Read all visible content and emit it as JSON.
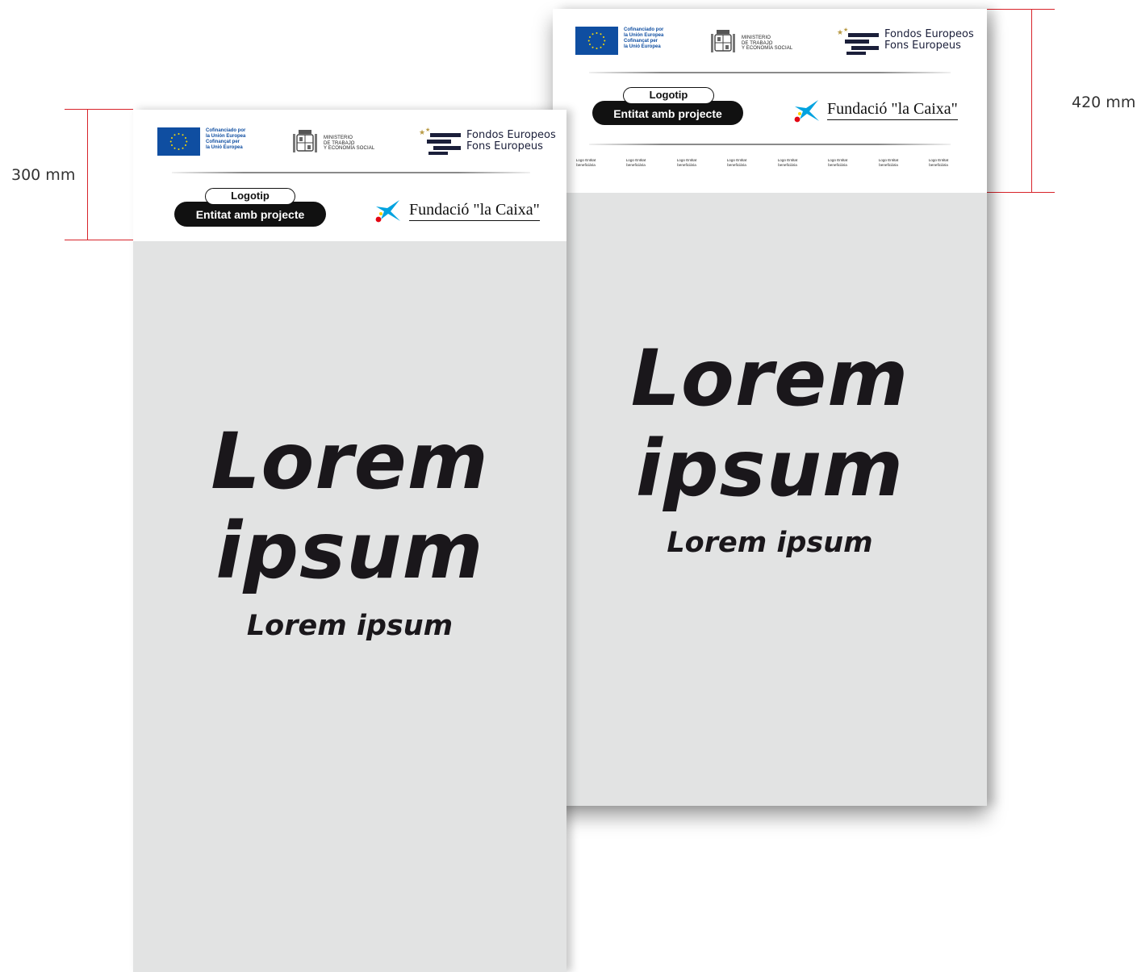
{
  "dimensions": {
    "small": "300 mm",
    "large": "420 mm"
  },
  "eu": {
    "line1": "Cofinanciado por",
    "line2": "la Unión Europea",
    "line3": "Cofinançat per",
    "line4": "la Unió Europea"
  },
  "ministerio": {
    "line1": "MINISTERIO",
    "line2": "DE TRABAJO",
    "line3": "Y ECONOMÍA SOCIAL"
  },
  "fondos": {
    "line1": "Fondos Europeos",
    "line2": "Fons Europeus"
  },
  "project_logo": {
    "top": "Logotip",
    "bottom": "Entitat amb projecte"
  },
  "caixa": {
    "name": "Fundació \"la Caixa\""
  },
  "beneficiaries": [
    "Logo Entitat beneficiària",
    "Logo Entitat beneficiària",
    "Logo Entitat beneficiària",
    "Logo Entitat beneficiària",
    "Logo Entitat beneficiària",
    "Logo Entitat beneficiària",
    "Logo Entitat beneficiària",
    "Logo Entitat beneficiària"
  ],
  "headline": {
    "line1": "Lorem",
    "line2": "ipsum",
    "sub": "Lorem ipsum"
  },
  "colors": {
    "eu_blue": "#0f4ea1",
    "eu_star": "#ffdd00",
    "panel_gray": "#e2e3e3",
    "dimension_red": "#d8232a",
    "caixa_blue": "#00a3e0",
    "caixa_red": "#e30613",
    "caixa_yellow": "#ffd200"
  }
}
